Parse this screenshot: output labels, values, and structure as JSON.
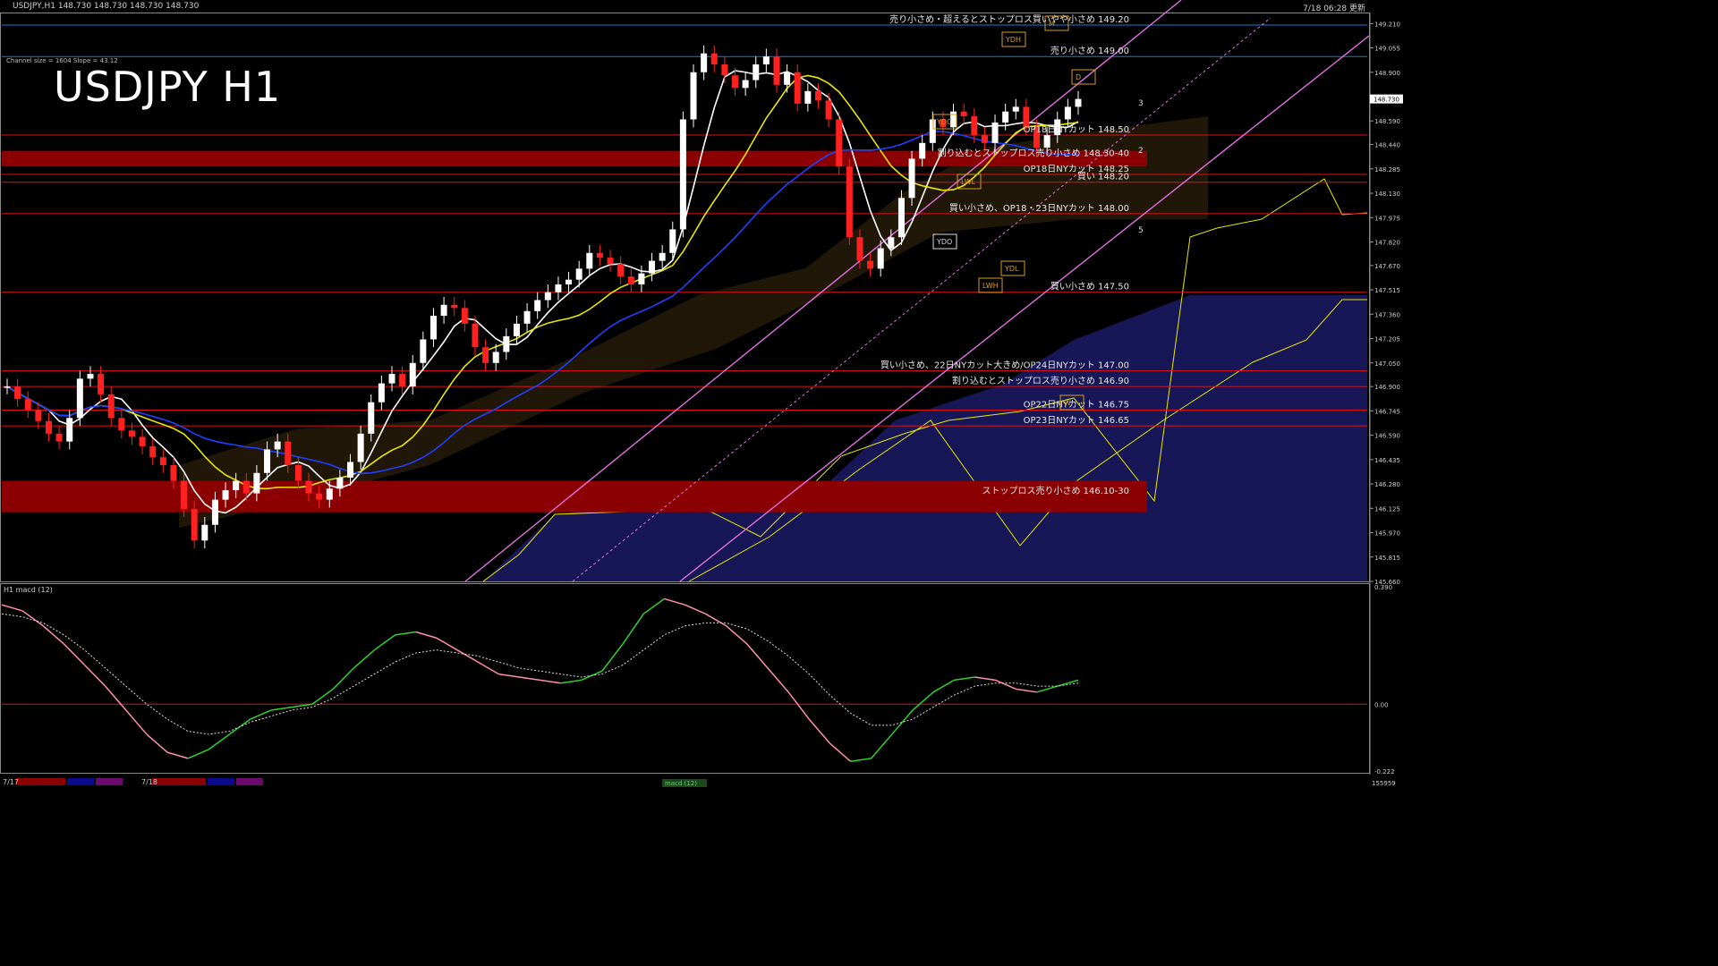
{
  "header": {
    "symbol": "USDJPY,H1",
    "ohlc": "148.730 148.730 148.730 148.730",
    "updated": "7/18 06:28 更新"
  },
  "channel_info": "Channel size = 1604 Slope = 43.12",
  "title": "USDJPY H1",
  "subwindow_title": "H1 macd (12)",
  "date_labels": [
    "7/17",
    "7/18"
  ],
  "status_label": "macd (12)",
  "bottom_right_value": "155959",
  "colors": {
    "support_line": "#e01010",
    "blue_line": "#1a7bd6",
    "band_dark": "#8b0000",
    "label_text": "#e6e6e6",
    "macd_up": "#2fd12f",
    "macd_down": "#ff8fb0",
    "kumo": "#2a2aa0",
    "yellow_line": "#e8e800"
  },
  "chart_data": [
    {
      "type": "candlestick",
      "title": "USDJPY H1",
      "ylim": [
        145.66,
        149.28
      ],
      "y_ticks": [
        149.21,
        149.055,
        148.9,
        148.745,
        148.59,
        148.44,
        148.285,
        148.13,
        147.975,
        147.82,
        147.67,
        147.515,
        147.36,
        147.205,
        147.05,
        146.9,
        146.745,
        146.59,
        146.435,
        146.28,
        146.125,
        145.97,
        145.815,
        145.66
      ],
      "current_price": 148.73,
      "closes": [
        146.9,
        146.82,
        146.75,
        146.68,
        146.6,
        146.55,
        146.7,
        146.95,
        146.98,
        146.85,
        146.7,
        146.62,
        146.58,
        146.52,
        146.45,
        146.4,
        146.3,
        146.12,
        145.92,
        146.02,
        146.18,
        146.24,
        146.3,
        146.22,
        146.35,
        146.5,
        146.55,
        146.4,
        146.3,
        146.22,
        146.18,
        146.25,
        146.32,
        146.42,
        146.6,
        146.8,
        146.92,
        146.98,
        146.9,
        147.05,
        147.2,
        147.35,
        147.42,
        147.4,
        147.3,
        147.15,
        147.05,
        147.12,
        147.22,
        147.3,
        147.38,
        147.45,
        147.5,
        147.55,
        147.58,
        147.65,
        147.75,
        147.72,
        147.68,
        147.6,
        147.55,
        147.62,
        147.7,
        147.75,
        147.9,
        148.6,
        148.9,
        149.02,
        148.95,
        148.88,
        148.8,
        148.85,
        148.95,
        149.0,
        148.82,
        148.9,
        148.7,
        148.78,
        148.72,
        148.6,
        148.3,
        147.85,
        147.7,
        147.65,
        147.78,
        147.85,
        148.1,
        148.35,
        148.45,
        148.6,
        148.55,
        148.65,
        148.62,
        148.5,
        148.45,
        148.58,
        148.65,
        148.68,
        148.55,
        148.42,
        148.5,
        148.6,
        148.68,
        148.73
      ],
      "horizontal_levels": [
        {
          "label": "売り小さめ・超えるとストップロス買いやや小さめ 149.20",
          "value": 149.2,
          "color": "#1a7bd6"
        },
        {
          "label": "売り小さめ 149.00",
          "value": 149.0,
          "color": "#1a7bd6"
        },
        {
          "label": "OP18日NYカット 148.50",
          "value": 148.5,
          "color": "#e01010"
        },
        {
          "label": "割り込むとストップロス売り小さめ 148.30-40",
          "value": 148.35,
          "color": "#8b0000",
          "band": [
            148.3,
            148.4
          ]
        },
        {
          "label": "OP18日NYカット 148.25",
          "value": 148.25,
          "color": "#e01010"
        },
        {
          "label": "買い 148.20",
          "value": 148.2,
          "color": "#e01010"
        },
        {
          "label": "買い小さめ、OP18・23日NYカット 148.00",
          "value": 148.0,
          "color": "#e01010"
        },
        {
          "label": "買い小さめ 147.50",
          "value": 147.5,
          "color": "#e01010"
        },
        {
          "label": "買い小さめ、22日NYカット大きめ/OP24日NYカット 147.00",
          "value": 147.0,
          "color": "#e01010"
        },
        {
          "label": "割り込むとストップロス売り小さめ 146.90",
          "value": 146.9,
          "color": "#e01010"
        },
        {
          "label": "OP22日NYカット 146.75",
          "value": 146.75,
          "color": "#e01010"
        },
        {
          "label": "OP23日NYカット 146.65",
          "value": 146.65,
          "color": "#e01010"
        },
        {
          "label": "ストップロス売り小さめ 146.10-30",
          "value": 146.2,
          "color": "#8b0000",
          "band": [
            146.1,
            146.3
          ]
        }
      ],
      "box_labels": [
        "YDH",
        "YDC",
        "YDO",
        "YDL",
        "LWH",
        "LWL",
        "D",
        "W",
        "M"
      ],
      "projection_labels": [
        "3",
        "2",
        "5"
      ]
    },
    {
      "type": "line",
      "title": "H1 macd (12)",
      "ylim": [
        -0.222,
        0.39
      ],
      "y_ticks": [
        0.39,
        0.0,
        -0.222
      ],
      "series": [
        {
          "name": "macd",
          "values": [
            0.33,
            0.31,
            0.26,
            0.2,
            0.13,
            0.06,
            -0.02,
            -0.1,
            -0.16,
            -0.18,
            -0.15,
            -0.1,
            -0.05,
            -0.02,
            -0.01,
            0.0,
            0.05,
            0.12,
            0.18,
            0.23,
            0.24,
            0.22,
            0.18,
            0.14,
            0.1,
            0.09,
            0.08,
            0.07,
            0.08,
            0.11,
            0.2,
            0.3,
            0.35,
            0.33,
            0.3,
            0.26,
            0.2,
            0.12,
            0.04,
            -0.05,
            -0.13,
            -0.19,
            -0.18,
            -0.1,
            -0.02,
            0.04,
            0.08,
            0.09,
            0.08,
            0.05,
            0.04,
            0.06,
            0.08
          ]
        },
        {
          "name": "signal",
          "values": [
            0.3,
            0.29,
            0.27,
            0.23,
            0.18,
            0.12,
            0.06,
            0.0,
            -0.05,
            -0.09,
            -0.1,
            -0.09,
            -0.06,
            -0.04,
            -0.02,
            -0.01,
            0.02,
            0.06,
            0.1,
            0.14,
            0.17,
            0.18,
            0.17,
            0.16,
            0.14,
            0.12,
            0.11,
            0.1,
            0.09,
            0.1,
            0.13,
            0.18,
            0.23,
            0.26,
            0.27,
            0.27,
            0.25,
            0.21,
            0.16,
            0.1,
            0.03,
            -0.03,
            -0.07,
            -0.07,
            -0.05,
            -0.01,
            0.03,
            0.06,
            0.07,
            0.07,
            0.06,
            0.06,
            0.07
          ]
        }
      ]
    }
  ]
}
